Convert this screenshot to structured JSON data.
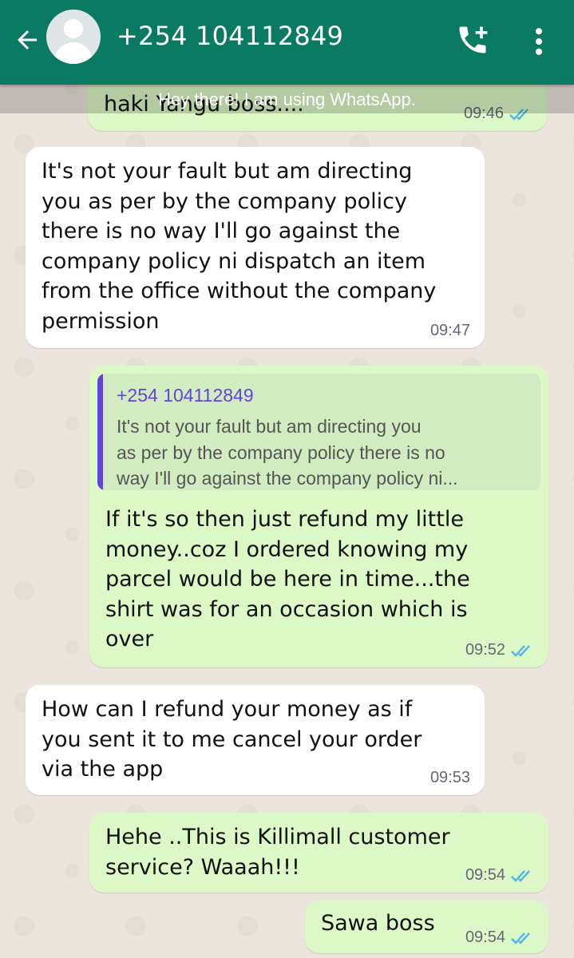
{
  "header": {
    "contact": "+254 104112849",
    "back_icon": "arrow-left-icon",
    "call_icon": "add-call-icon",
    "menu_icon": "more-vert-icon"
  },
  "banner": {
    "status": "Hey there! I am using WhatsApp."
  },
  "messages": [
    {
      "dir": "out",
      "text": "haki Yangu boss....",
      "time": "09:46",
      "read": true
    },
    {
      "dir": "in",
      "text": "It's not your fault but am directing\nyou as per by the company policy\nthere is no way I'll go against the\ncompany policy ni dispatch an item\nfrom the office without the company\npermission",
      "time": "09:47"
    },
    {
      "dir": "out",
      "quote": {
        "name": "+254 104112849",
        "text": "It's not your fault but am directing you\nas per by the company policy there is no\nway I'll go against the company policy ni..."
      },
      "text": "If it's so then just refund my little\nmoney..coz I ordered knowing my\nparcel would be here in time...the\nshirt was for an occasion which is\nover",
      "time": "09:52",
      "read": true
    },
    {
      "dir": "in",
      "text": "How can I refund your money as if\nyou sent it to me cancel your order\nvia the app",
      "time": "09:53"
    },
    {
      "dir": "out",
      "text": "Hehe ..This is Killimall customer\nservice? Waaah!!!",
      "time": "09:54",
      "read": true
    },
    {
      "dir": "out",
      "text": "Sawa boss",
      "time": "09:54",
      "read": true
    }
  ],
  "colors": {
    "header": "#0b7a63",
    "outgoing": "#dcf8c6",
    "incoming": "#ffffff",
    "read_ticks": "#4fb6ec",
    "quote_name": "#6443d8"
  }
}
